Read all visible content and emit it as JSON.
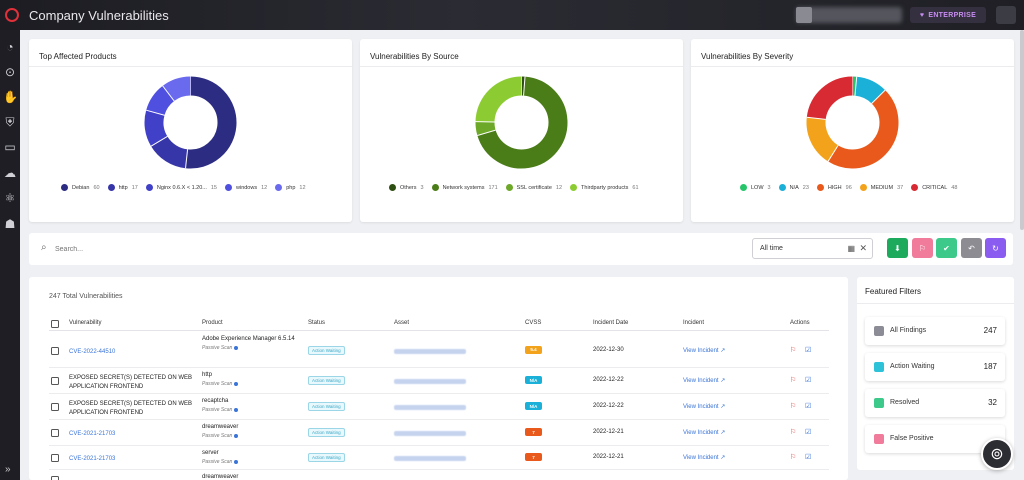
{
  "app": {
    "title": "Company Vulnerabilities",
    "badge_label": "ENTERPRISE",
    "colors": {
      "brand": "#e0303a",
      "badge": "#c58cf0"
    }
  },
  "sidebar": {
    "icons": [
      "dashboard-icon",
      "scan-icon",
      "hand-icon",
      "shield-icon",
      "monitor-icon",
      "cloud-icon",
      "network-icon",
      "hacker-icon"
    ],
    "expand_glyph": "»"
  },
  "charts": {
    "products": {
      "title": "Top Affected Products",
      "slices": [
        {
          "label": "Debian",
          "value": 60,
          "color": "#2c2c82"
        },
        {
          "label": "http",
          "value": 17,
          "color": "#3636a8"
        },
        {
          "label": "Nginx 0.6.X < 1.20...",
          "value": 15,
          "color": "#4040c8"
        },
        {
          "label": "windows",
          "value": 12,
          "color": "#4f4fe0"
        },
        {
          "label": "php",
          "value": 12,
          "color": "#6a6aee"
        }
      ]
    },
    "source": {
      "title": "Vulnerabilities By Source",
      "slices": [
        {
          "label": "Others",
          "value": 3,
          "color": "#2e4f12"
        },
        {
          "label": "Network systems",
          "value": 171,
          "color": "#4a7c18"
        },
        {
          "label": "SSL certificate",
          "value": 12,
          "color": "#6da828"
        },
        {
          "label": "Thirdparty products",
          "value": 61,
          "color": "#8ccc32"
        }
      ]
    },
    "severity": {
      "title": "Vulnerabilities By Severity",
      "slices": [
        {
          "label": "LOW",
          "value": 3,
          "color": "#27c56a"
        },
        {
          "label": "N/A",
          "value": 23,
          "color": "#1ab0d8"
        },
        {
          "label": "HIGH",
          "value": 96,
          "color": "#e8591b"
        },
        {
          "label": "MEDIUM",
          "value": 37,
          "color": "#f2a31b"
        },
        {
          "label": "CRITICAL",
          "value": 48,
          "color": "#d82a32"
        }
      ]
    }
  },
  "search": {
    "placeholder": "Search...",
    "time_range": "All time",
    "actions": [
      {
        "name": "download-button",
        "icon": "⬇",
        "color": "#1daa5c"
      },
      {
        "name": "report-button",
        "icon": "⚐",
        "color": "#f07b9a"
      },
      {
        "name": "resolve-button",
        "icon": "✔",
        "color": "#3cc98a"
      },
      {
        "name": "undo-button",
        "icon": "↶",
        "color": "#8c8c92"
      },
      {
        "name": "refresh-button",
        "icon": "↻",
        "color": "#8b5cf0"
      }
    ]
  },
  "table": {
    "total_label": "247 Total Vulnerabilities",
    "headers": {
      "vulnerability": "Vulnerability",
      "product": "Product",
      "status": "Status",
      "asset": "Asset",
      "cvss": "CVSS",
      "date": "Incident Date",
      "incident": "Incident",
      "actions": "Actions"
    },
    "rows": [
      {
        "vuln": "CVE-2022-44510",
        "vuln_link": true,
        "product": "Adobe Experience Manager 6.5.14",
        "scan": "Passive Scan",
        "status": "Action Waiting",
        "cvss": "5.4",
        "cvss_color": "#f2a31b",
        "date": "2022-12-30",
        "incident": "View Incident"
      },
      {
        "vuln": "EXPOSED SECRET(S) DETECTED ON WEB APPLICATION FRONTEND",
        "vuln_link": false,
        "product": "http",
        "scan": "Passive Scan",
        "status": "Action Waiting",
        "cvss": "N/A",
        "cvss_color": "#1ab0d8",
        "date": "2022-12-22",
        "incident": "View Incident"
      },
      {
        "vuln": "EXPOSED SECRET(S) DETECTED ON WEB APPLICATION FRONTEND",
        "vuln_link": false,
        "product": "recaptcha",
        "scan": "Passive Scan",
        "status": "Action Waiting",
        "cvss": "N/A",
        "cvss_color": "#1ab0d8",
        "date": "2022-12-22",
        "incident": "View Incident"
      },
      {
        "vuln": "CVE-2021-21703",
        "vuln_link": true,
        "product": "dreamweaver",
        "scan": "Passive Scan",
        "status": "Action Waiting",
        "cvss": "7",
        "cvss_color": "#e8591b",
        "date": "2022-12-21",
        "incident": "View Incident"
      },
      {
        "vuln": "CVE-2021-21703",
        "vuln_link": true,
        "product": "server",
        "scan": "Passive Scan",
        "status": "Action Waiting",
        "cvss": "7",
        "cvss_color": "#e8591b",
        "date": "2022-12-21",
        "incident": "View Incident"
      },
      {
        "vuln": "",
        "vuln_link": true,
        "product": "dreamweaver",
        "scan": "",
        "status": "",
        "cvss": "",
        "cvss_color": "#e8591b",
        "date": "",
        "incident": ""
      }
    ]
  },
  "featured_filters": {
    "title": "Featured Filters",
    "items": [
      {
        "label": "All Findings",
        "count": "247",
        "color": "#8c8c96"
      },
      {
        "label": "Action Waiting",
        "count": "187",
        "color": "#2ec2d8"
      },
      {
        "label": "Resolved",
        "count": "32",
        "color": "#3cc98a"
      },
      {
        "label": "False Positive",
        "count": "",
        "color": "#f07b9a"
      }
    ]
  }
}
